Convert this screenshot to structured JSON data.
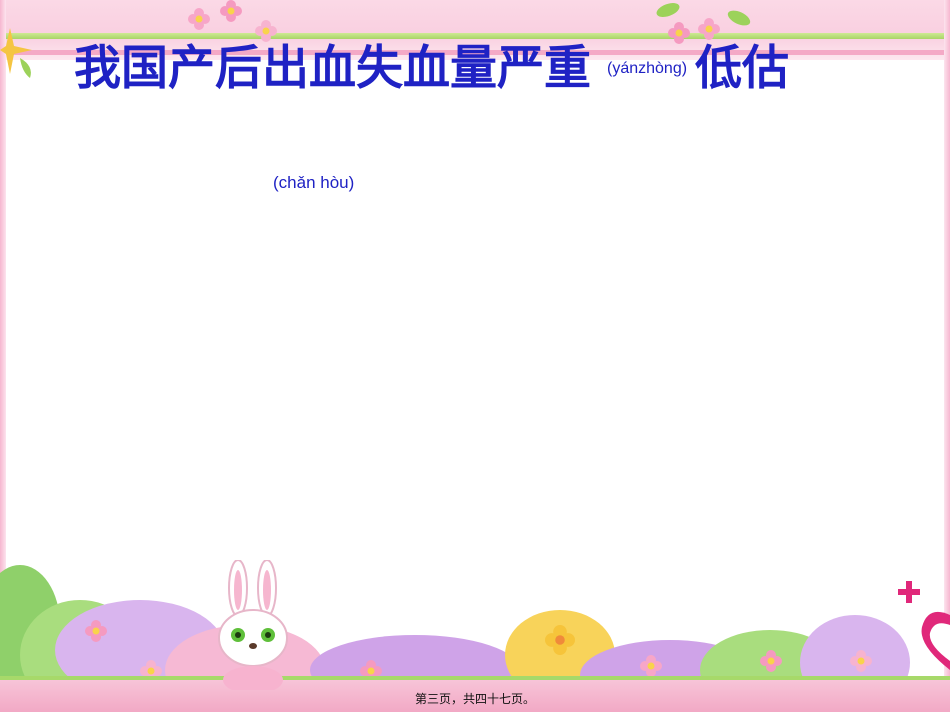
{
  "slide": {
    "title_main": "我国产后出血失血量严重",
    "title_pinyin": "(yánzhòng)",
    "title_tail": "低估",
    "body_pinyin": "(chǎn hòu)",
    "footer": "第三页，共四十七页。"
  },
  "decor": {
    "icons": [
      "flower-icon",
      "bunny-icon",
      "heart-icon",
      "plus-icon",
      "star-icon",
      "leaf-icon"
    ],
    "colors": {
      "title_text": "#1f22c4",
      "border_pink": "#f4a9c6",
      "border_green": "#a7d96a"
    }
  }
}
